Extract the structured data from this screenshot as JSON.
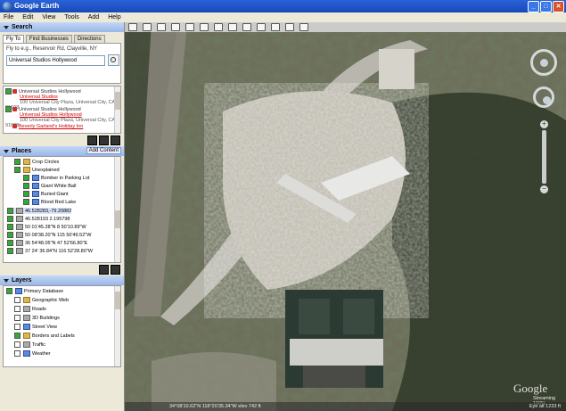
{
  "window": {
    "title": "Google Earth"
  },
  "menu": [
    "File",
    "Edit",
    "View",
    "Tools",
    "Add",
    "Help"
  ],
  "search": {
    "header": "Search",
    "tabs": [
      "Fly To",
      "Find Businesses",
      "Directions"
    ],
    "hint": "Fly to e.g., Reservoir Rd, Clayville, NY",
    "query": "Universal Studios Hollywood",
    "results": [
      {
        "title": "Universal Studios Hollywood",
        "link": "Universal Studios",
        "addr": "100 Universal City Plaza, Universal City, CA 91608"
      },
      {
        "title": "Universal Studios Hollywood",
        "link": "Universal Studios Hollywood",
        "addr": "100 Universal City Plaza, Universal City, CA 91608"
      },
      {
        "title": "",
        "link": "Beverly Garland's Holiday Inn",
        "addr": ""
      }
    ]
  },
  "places": {
    "header": "Places",
    "add_button": "Add Content",
    "items": [
      "Crop Circles",
      "Unexplained",
      "Bomber in Parking Lot",
      "Giant White Ball",
      "Buried Giant",
      "Blood Red Lake",
      "46.528283,-79.20882",
      "46.528193 2.195798",
      "50 01'45.28\"N 8 50'10.89\"W",
      "50 08'38.20\"N 115 50'49.52\"W",
      "36 54'48.05\"N 47 52'66.80\"E",
      "37 24' 36.84\"N 116 52'28.80\"W"
    ]
  },
  "layers": {
    "header": "Layers",
    "items": [
      "Primary Database",
      "Geographic Web",
      "Roads",
      "3D Buildings",
      "Street View",
      "Borders and Labels",
      "Traffic",
      "Weather"
    ]
  },
  "map": {
    "watermark": "Google",
    "status_coords": "34°08'10.62\"N 118°20'35.34\"W elev 742 ft",
    "streaming": "Streaming 100%",
    "eye_alt": "Eye alt 1233 ft"
  }
}
